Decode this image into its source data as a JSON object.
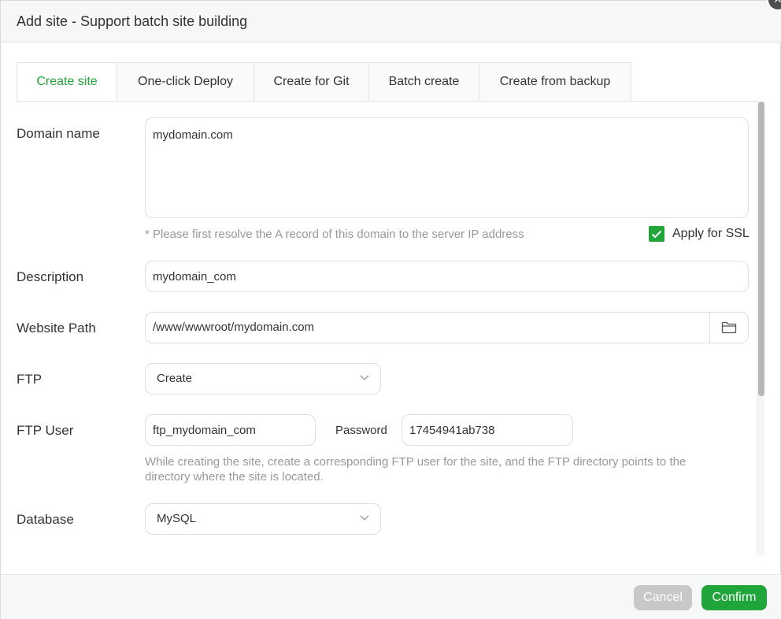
{
  "dialog": {
    "title": "Add site - Support batch site building",
    "close_icon": "close-icon"
  },
  "tabs": [
    {
      "label": "Create site",
      "active": true
    },
    {
      "label": "One-click Deploy",
      "active": false
    },
    {
      "label": "Create for Git",
      "active": false
    },
    {
      "label": "Batch create",
      "active": false
    },
    {
      "label": "Create from backup",
      "active": false
    }
  ],
  "form": {
    "domain": {
      "label": "Domain name",
      "value": "mydomain.com",
      "hint": "* Please first resolve the A record of this domain to the server IP address"
    },
    "ssl": {
      "label": "Apply for SSL",
      "checked": true
    },
    "description": {
      "label": "Description",
      "value": "mydomain_com"
    },
    "website_path": {
      "label": "Website Path",
      "value": "/www/wwwroot/mydomain.com",
      "icon": "folder-icon"
    },
    "ftp": {
      "label": "FTP",
      "selected": "Create"
    },
    "ftp_user": {
      "label": "FTP User",
      "value": "ftp_mydomain_com",
      "password_label": "Password",
      "password_value": "17454941ab738",
      "hint_line1": "While creating the site, create a corresponding FTP user for the site, and the FTP directory points to the",
      "hint_line2": "directory where the site is located."
    },
    "database": {
      "label": "Database",
      "selected": "MySQL"
    }
  },
  "footer": {
    "cancel_label": "Cancel",
    "confirm_label": "Confirm"
  },
  "colors": {
    "accent": "#20a53a",
    "disabled": "#c8c8c8"
  }
}
